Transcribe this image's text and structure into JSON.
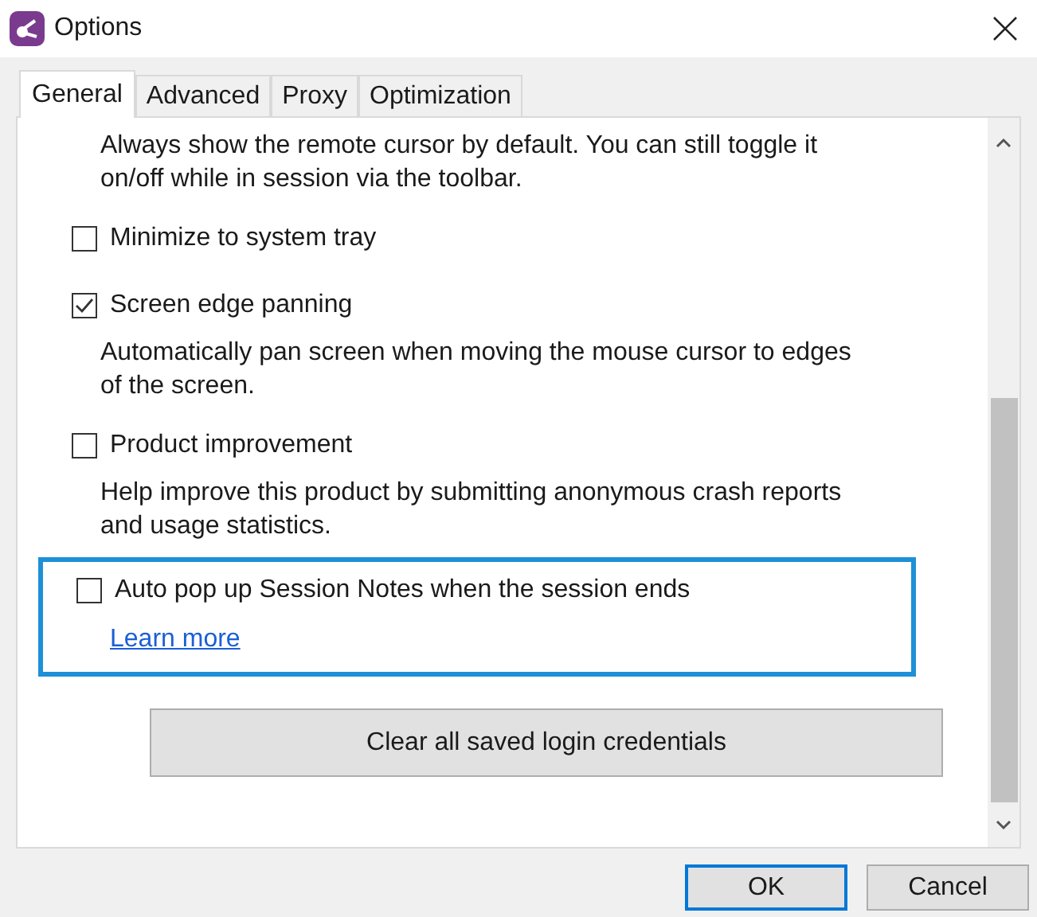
{
  "window": {
    "title": "Options"
  },
  "tabs": [
    {
      "label": "General",
      "selected": true
    },
    {
      "label": "Advanced",
      "selected": false
    },
    {
      "label": "Proxy",
      "selected": false
    },
    {
      "label": "Optimization",
      "selected": false
    }
  ],
  "sections": [
    {
      "description": "Always show the remote cursor by default. You can still toggle it on/off while in session via the toolbar.",
      "highlighted": false
    },
    {
      "label": "Minimize to system tray",
      "checked": false,
      "highlighted": false
    },
    {
      "label": "Screen edge panning",
      "checked": true,
      "description": "Automatically pan screen when moving the mouse cursor to edges of the screen.",
      "highlighted": false
    },
    {
      "label": "Product improvement",
      "checked": false,
      "description": "Help improve this product by submitting anonymous crash reports and usage statistics.",
      "highlighted": false
    },
    {
      "label": "Auto pop up Session Notes when the session ends",
      "checked": false,
      "link": "Learn more",
      "highlighted": true
    }
  ],
  "action_button": "Clear all saved login credentials",
  "buttons": [
    {
      "label": "OK",
      "default": true
    },
    {
      "label": "Cancel",
      "default": false
    }
  ]
}
